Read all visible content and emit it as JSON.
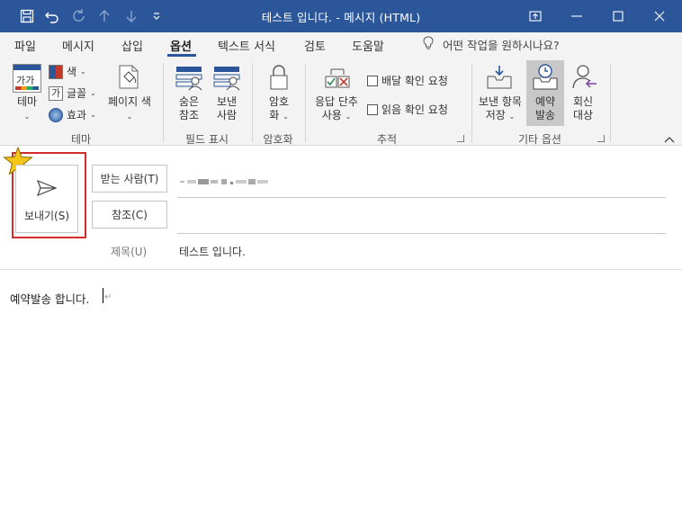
{
  "window": {
    "title": "테스트 입니다.  -  메시지 (HTML)"
  },
  "menu": {
    "items": [
      "파일",
      "메시지",
      "삽입",
      "옵션",
      "텍스트 서식",
      "검토",
      "도움말"
    ],
    "active": "옵션",
    "tell_me": "어떤 작업을 원하시나요?"
  },
  "ribbon": {
    "theme_group": {
      "label": "테마",
      "theme_btn": "테마",
      "theme_icon_text": "가가",
      "colors": "색",
      "fonts": "글꼴",
      "effects": "효과",
      "page_color_line1": "페이지 색"
    },
    "fields_group": {
      "label": "필드 표시",
      "bcc_line1": "숨은",
      "bcc_line2": "참조",
      "from_line1": "보낸",
      "from_line2": "사람"
    },
    "encrypt_group": {
      "label": "암호화",
      "encrypt_line1": "암호",
      "encrypt_line2": "화"
    },
    "tracking_group": {
      "label": "추적",
      "voting_line1": "응답 단추",
      "voting_line2": "사용",
      "delivery_receipt": "배달 확인 요청",
      "read_receipt": "읽음 확인 요청"
    },
    "more_group": {
      "label": "기타 옵션",
      "save_sent_line1": "보낸 항목",
      "save_sent_line2": "저장",
      "delay_line1": "예약",
      "delay_line2": "발송",
      "reply_line1": "회신",
      "reply_line2": "대상"
    }
  },
  "compose": {
    "send_label": "보내기(S)",
    "to_btn": "받는 사람(T)",
    "cc_btn": "참조(C)",
    "subject_label": "제목(U)",
    "subject_value": "테스트 입니다.",
    "body_text": "예약발송 합니다."
  },
  "colors": {
    "titlebar": "#2b579a",
    "highlight_box": "#d12b2b",
    "star": "#f5c518"
  }
}
